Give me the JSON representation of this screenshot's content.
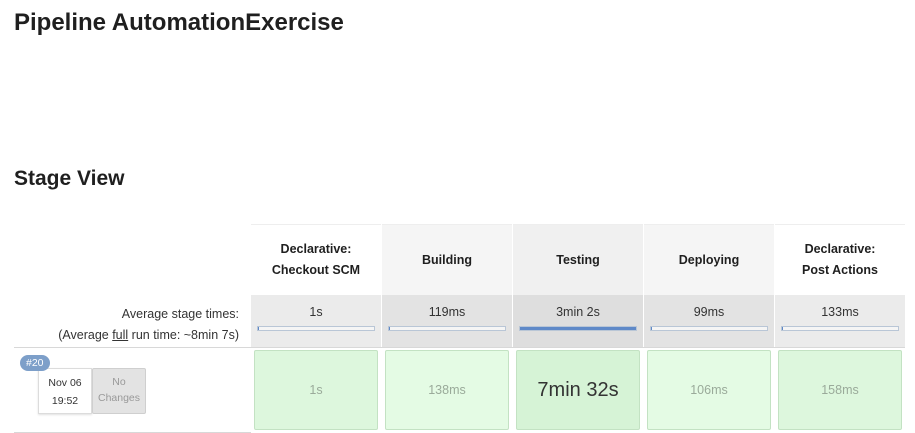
{
  "page": {
    "title": "Pipeline AutomationExercise",
    "section_title": "Stage View"
  },
  "summary": {
    "avg_label": "Average stage times:",
    "avg_full_prefix": "(Average ",
    "avg_full_link": "full",
    "avg_full_suffix": " run time: ~8min 7s)"
  },
  "build": {
    "number": "#20",
    "date": "Nov 06",
    "time": "19:52",
    "changes": "No Changes"
  },
  "stages": [
    {
      "name_line1": "Declarative:",
      "name_line2": "Checkout SCM",
      "avg": "1s",
      "avg_fraction": 0.003,
      "duration": "1s"
    },
    {
      "name_line1": "Building",
      "name_line2": "",
      "avg": "119ms",
      "avg_fraction": 0.001,
      "duration": "138ms"
    },
    {
      "name_line1": "Testing",
      "name_line2": "",
      "avg": "3min 2s",
      "avg_fraction": 1.0,
      "duration": "7min 32s"
    },
    {
      "name_line1": "Deploying",
      "name_line2": "",
      "avg": "99ms",
      "avg_fraction": 0.001,
      "duration": "106ms"
    },
    {
      "name_line1": "Declarative:",
      "name_line2": "Post Actions",
      "avg": "133ms",
      "avg_fraction": 0.001,
      "duration": "158ms"
    }
  ],
  "colors": {
    "success_cell": "#ddf7dd",
    "avg_bar_fill": "#5f89c8",
    "build_badge": "#7d9fc9"
  }
}
